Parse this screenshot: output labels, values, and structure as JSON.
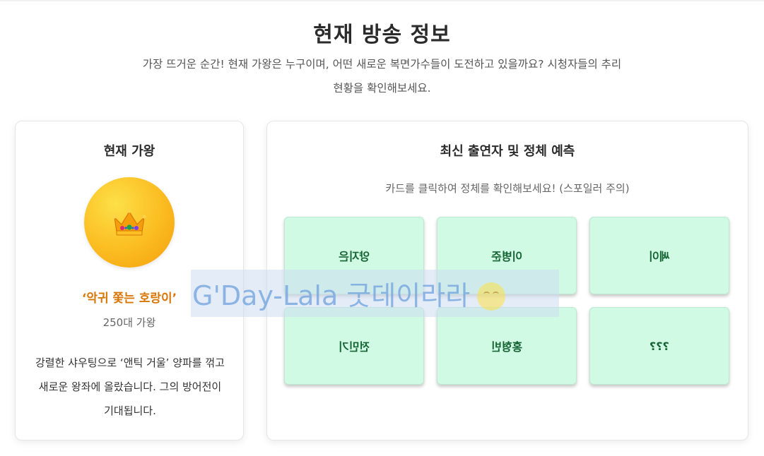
{
  "header": {
    "title": "현재 방송 정보",
    "subtitle": "가장 뜨거운 순간! 현재 가왕은 누구이며, 어떤 새로운 복면가수들이 도전하고 있을까요? 시청자들의 추리 현황을 확인해보세요."
  },
  "king": {
    "heading": "현재 가왕",
    "icon": "crown-icon",
    "name": "‘악귀 쫓는 호랑이’",
    "reign": "250대 가왕",
    "description": "강렬한 샤우팅으로 ‘앤틱 거울’ 양파를 꺾고 새로운 왕좌에 올랐습니다. 그의 방어전이 기대됩니다.",
    "accent_color": "#d97706"
  },
  "contestants": {
    "heading": "최신 출연자 및 정체 예측",
    "hint": "카드를 클릭하여 정체를 확인해보세요! (스포일러 주의)",
    "cards": [
      {
        "label": "양지은"
      },
      {
        "label": "이병준"
      },
      {
        "label": "쎄이"
      },
      {
        "label": "전민기"
      },
      {
        "label": "홍형빈"
      },
      {
        "label": "???"
      }
    ],
    "card_color": "#d1fae5"
  },
  "watermark": {
    "text": "G'Day-Lala 굿데이라라"
  }
}
